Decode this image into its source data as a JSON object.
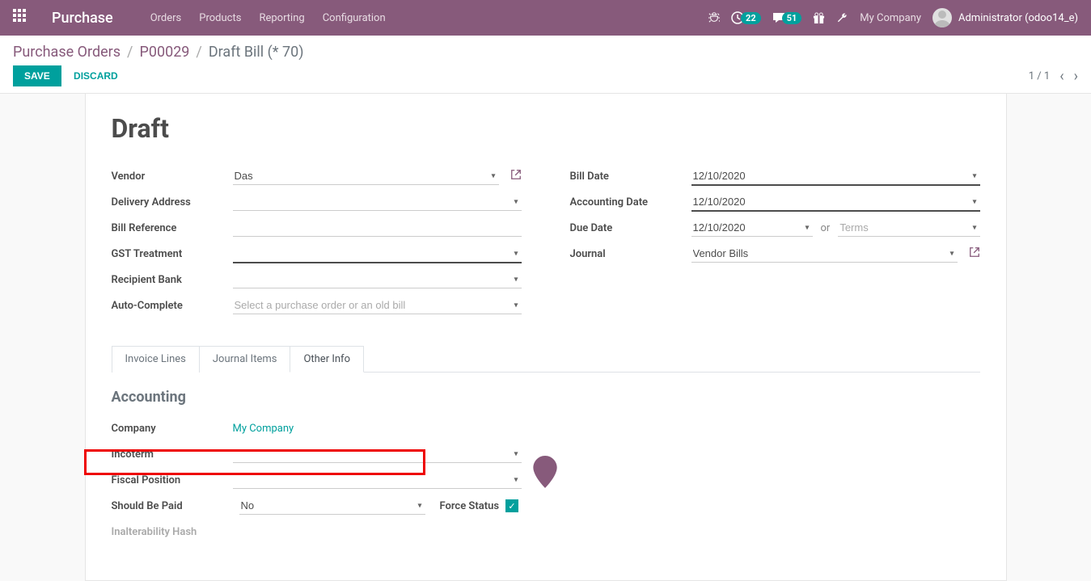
{
  "navbar": {
    "brand": "Purchase",
    "menu": {
      "orders": "Orders",
      "products": "Products",
      "reporting": "Reporting",
      "configuration": "Configuration"
    },
    "activity_count": "22",
    "messages_count": "51",
    "company": "My Company",
    "user": "Administrator (odoo14_e)"
  },
  "breadcrumb": {
    "root": "Purchase Orders",
    "po": "P00029",
    "current": "Draft Bill (* 70)"
  },
  "controls": {
    "save": "SAVE",
    "discard": "DISCARD",
    "pager": "1 / 1"
  },
  "form": {
    "title": "Draft",
    "left": {
      "vendor_label": "Vendor",
      "vendor_value": "Das",
      "delivery_label": "Delivery Address",
      "delivery_value": "",
      "billref_label": "Bill Reference",
      "billref_value": "",
      "gst_label": "GST Treatment",
      "gst_value": "",
      "bank_label": "Recipient Bank",
      "bank_value": "",
      "auto_label": "Auto-Complete",
      "auto_placeholder": "Select a purchase order or an old bill"
    },
    "right": {
      "billdate_label": "Bill Date",
      "billdate_value": "12/10/2020",
      "accdate_label": "Accounting Date",
      "accdate_value": "12/10/2020",
      "duedate_label": "Due Date",
      "duedate_value": "12/10/2020",
      "or": "or",
      "terms_placeholder": "Terms",
      "journal_label": "Journal",
      "journal_value": "Vendor Bills"
    }
  },
  "tabs": {
    "invoice_lines": "Invoice Lines",
    "journal_items": "Journal Items",
    "other_info": "Other Info"
  },
  "accounting": {
    "section": "Accounting",
    "company_label": "Company",
    "company_value": "My Company",
    "incoterm_label": "Incoterm",
    "fiscal_label": "Fiscal Position",
    "should_paid_label": "Should Be Paid",
    "should_paid_value": "No",
    "force_label": "Force Status",
    "hash_label": "Inalterability Hash"
  }
}
